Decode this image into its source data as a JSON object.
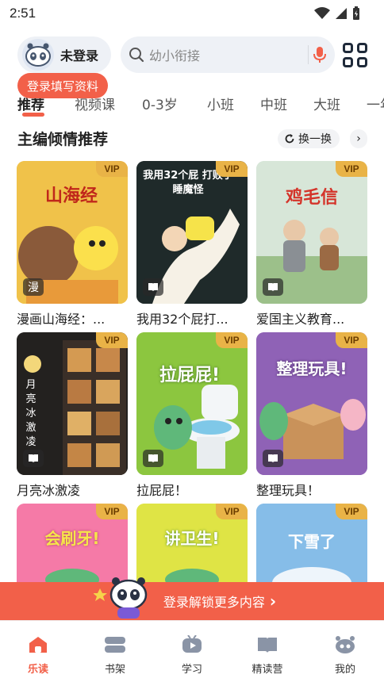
{
  "status": {
    "time": "2:51"
  },
  "header": {
    "login_label": "未登录",
    "search_placeholder": "幼小衔接",
    "login_tip": "登录填写资料"
  },
  "tabs": [
    "推荐",
    "视频课",
    "0-3岁",
    "小班",
    "中班",
    "大班",
    "一年"
  ],
  "section": {
    "title": "主编倾情推荐",
    "refresh_label": "换一换"
  },
  "vip_label": "VIP",
  "books": [
    {
      "title": "漫画山海经：...",
      "badge": "漫",
      "cover_text": "山海经",
      "colors": {
        "bg": "#ecb93a"
      }
    },
    {
      "title": "我用32个屁打...",
      "badge": "book-icon",
      "cover_text": "我用32个屁 打败了睡魔怪",
      "colors": {
        "bg": "#1f2a2a"
      }
    },
    {
      "title": "爱国主义教育...",
      "badge": "book-icon",
      "cover_text": "鸡毛信",
      "colors": {
        "bg": "#cfe0d0"
      }
    },
    {
      "title": "月亮冰激凌",
      "badge": "book-icon",
      "cover_text": "月亮冰激凌",
      "colors": {
        "bg": "#2b2622"
      }
    },
    {
      "title": "拉屁屁！",
      "badge": "book-icon",
      "cover_text": "拉屁屁!",
      "colors": {
        "bg": "#8cc63f"
      }
    },
    {
      "title": "整理玩具！",
      "badge": "book-icon",
      "cover_text": "整理玩具!",
      "colors": {
        "bg": "#8a5cb0"
      }
    },
    {
      "title": "",
      "badge": "",
      "cover_text": "会刷牙!",
      "colors": {
        "bg": "#f57aa7"
      }
    },
    {
      "title": "",
      "badge": "",
      "cover_text": "讲卫生!",
      "colors": {
        "bg": "#e3e64a"
      }
    },
    {
      "title": "",
      "badge": "",
      "cover_text": "下雪了",
      "colors": {
        "bg": "#7eb6e6"
      }
    }
  ],
  "banner": {
    "text": "登录解锁更多内容"
  },
  "nav": [
    "乐读",
    "书架",
    "学习",
    "精读营",
    "我的"
  ],
  "colors": {
    "accent": "#f26049",
    "vip": "#e9b347"
  }
}
